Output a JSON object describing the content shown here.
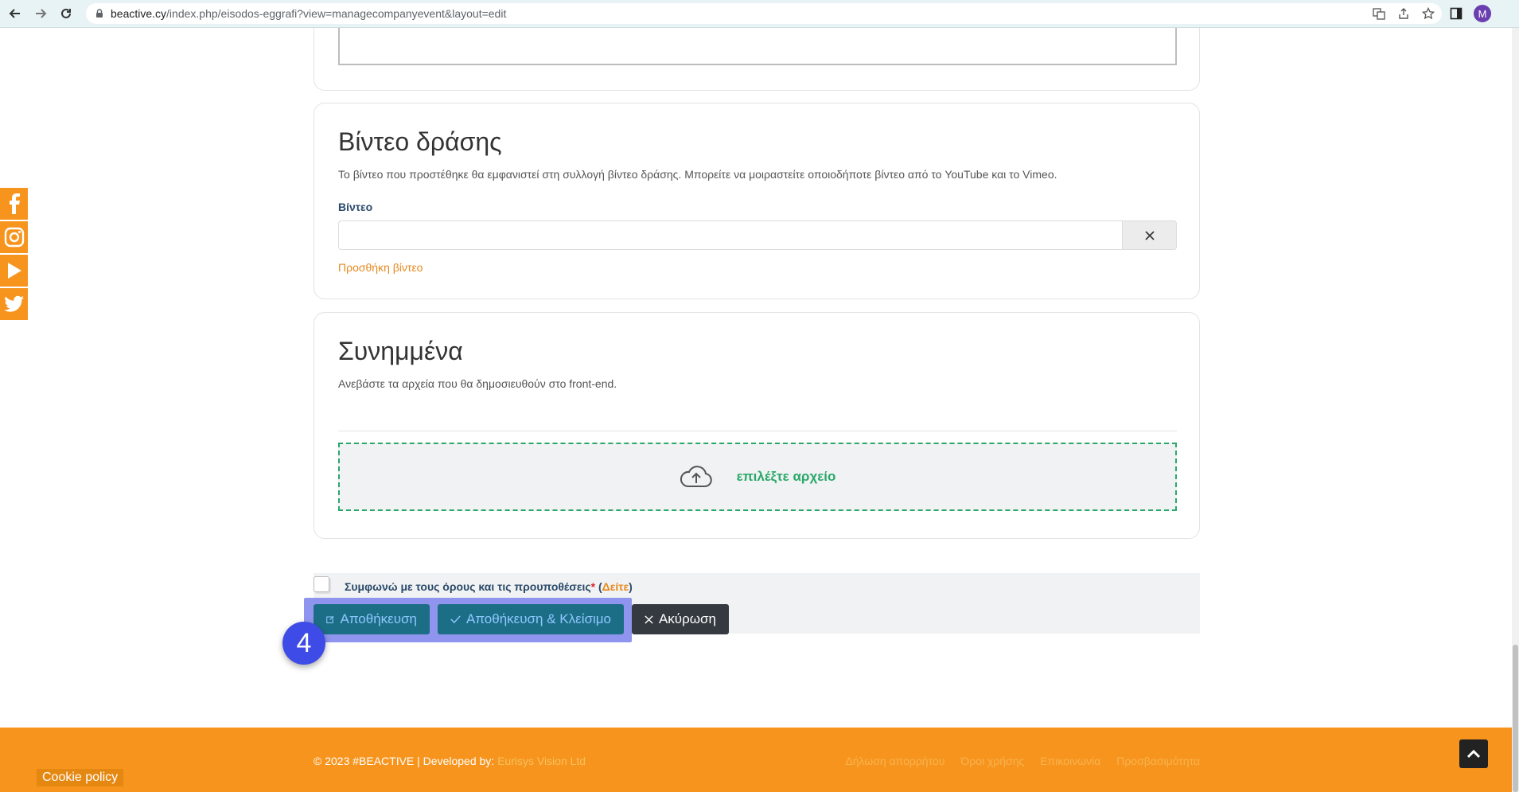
{
  "browser": {
    "url_host": "beactive.cy",
    "url_path": "/index.php/eisodos-eggrafi?view=managecompanyevent&layout=edit",
    "profile_initial": "M"
  },
  "social": {
    "items": [
      "facebook-icon",
      "instagram-icon",
      "youtube-icon",
      "twitter-icon"
    ],
    "color": "#f7941d"
  },
  "video_section": {
    "title": "Βίντεο δράσης",
    "description": "Το βίντεο που προστέθηκε θα εμφανιστεί στη συλλογή βίντεο δράσης. Μπορείτε να μοιραστείτε οποιοδήποτε βίντεο από το YouTube και το Vimeo.",
    "field_label": "Βίντεο",
    "field_value": "",
    "add_link": "Προσθήκη βίντεο"
  },
  "attachments_section": {
    "title": "Συνημμένα",
    "description": "Ανεβάστε τα αρχεία που θα δημοσιευθούν στο front-end.",
    "upload_label": "επιλέξτε αρχείο"
  },
  "terms": {
    "text": "Συμφωνώ με τους όρους και τις προυποθέσεις",
    "required_mark": "*",
    "open_paren": " (",
    "see_link": "Δείτε",
    "close_paren": ")"
  },
  "actions": {
    "save_label": "Αποθήκευση",
    "save_close_label": "Αποθήκευση & Κλείσιμο",
    "cancel_label": "Ακύρωση"
  },
  "step_badge": "4",
  "footer": {
    "copyright": "© 2023 #BEACTIVE | Developed by: ",
    "developer": "Eurisys Vision Ltd",
    "links": [
      "Δήλωση απορρήτου",
      "Όροι χρήσης",
      "Επικοινωνία",
      "Προσβασιμότητα"
    ],
    "cookie_policy": "Cookie policy"
  },
  "colors": {
    "brand_orange": "#f7941d",
    "primary_button": "#1c6e86",
    "cancel_button": "#343a40",
    "upload_green": "#2aa86a",
    "highlight": "#8f95ee",
    "badge": "#3f4be6"
  }
}
